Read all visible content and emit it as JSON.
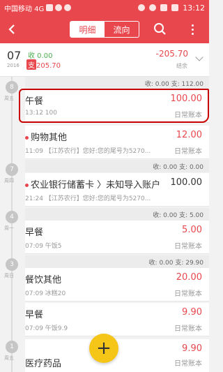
{
  "status_bar": {
    "carrier": "中国移动 4G",
    "time": "13:12"
  },
  "app_bar": {
    "tabs": [
      "明细",
      "流向"
    ],
    "active_tab": "明细"
  },
  "month_summary": {
    "month": "07",
    "year": "2016",
    "income": "收 0.00",
    "expense_tag": "支",
    "expense_value": "205.70",
    "total": "-205.70",
    "balance_label": "结余"
  },
  "days": [
    {
      "badge": "8",
      "week": "周五",
      "summary": "收: 0.00  支: 112.00",
      "transactions": [
        {
          "title": "午餐",
          "sub": "13:12  100",
          "amount": "100.00",
          "account": "日常账本",
          "dot": false,
          "amount_color": "red"
        },
        {
          "title": "购物其他",
          "sub": "11:09 【江苏农行】您好:您的尾号为5270...",
          "amount": "12.00",
          "account": "日常账本",
          "dot": true,
          "amount_color": "red"
        }
      ]
    },
    {
      "badge": "7",
      "week": "周四",
      "summary": "收: 0.00  支: 0.00",
      "transactions": [
        {
          "title": "农业银行储蓄卡 〉未知导入账户",
          "sub": "21:24 【江苏农行】您好:您的尾号为5270...",
          "amount": "100.00",
          "account": "",
          "dot": true,
          "amount_color": "neutral"
        }
      ]
    },
    {
      "badge": "4",
      "week": "周一",
      "summary": "收: 0.00  支: 5.00",
      "transactions": [
        {
          "title": "早餐",
          "sub": "07:09  午饭5",
          "amount": "5.00",
          "account": "日常账本",
          "dot": false,
          "amount_color": "red"
        }
      ]
    },
    {
      "badge": "3",
      "week": "周日",
      "summary": "收: 0.00  支: 29.90",
      "transactions": [
        {
          "title": "餐饮其他",
          "sub": "07:09  冰糕20",
          "amount": "20.00",
          "account": "日常账本",
          "dot": false,
          "amount_color": "red"
        },
        {
          "title": "早餐",
          "sub": "07:09  午饭9.9",
          "amount": "9.90",
          "account": "日常账本",
          "dot": false,
          "amount_color": "red"
        }
      ]
    },
    {
      "badge": "1",
      "week": "周五",
      "summary": "",
      "transactions": [
        {
          "title": "医疗药品",
          "sub": "",
          "amount": "9.90",
          "account": "日常账本",
          "dot": false,
          "amount_color": "red"
        }
      ]
    }
  ],
  "fab": {
    "label": "+"
  },
  "colors": {
    "primary": "#e8474d",
    "income": "#4caf50",
    "fab": "#f5c518",
    "highlight": "#c80000"
  },
  "icons": [
    "back-icon",
    "search-icon",
    "more-icon",
    "add-icon"
  ]
}
